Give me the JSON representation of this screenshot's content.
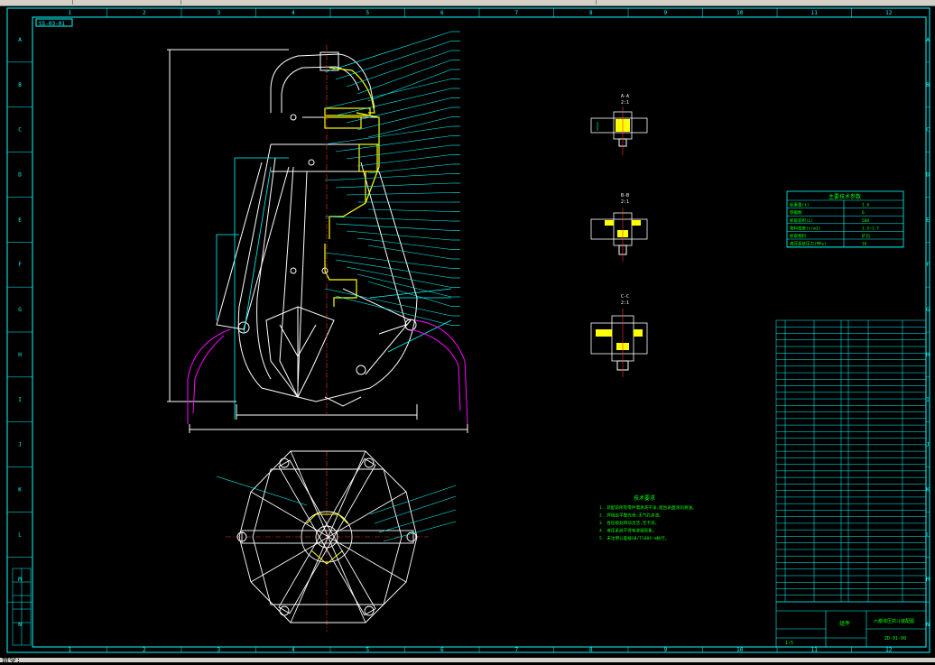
{
  "app": {
    "drawing_tag": "SS-03-01",
    "command_prompt": "命令:"
  },
  "border": {
    "columns": [
      "1",
      "2",
      "3",
      "4",
      "5",
      "6",
      "7",
      "8",
      "9",
      "10",
      "11",
      "12"
    ],
    "rows": [
      "A",
      "B",
      "C",
      "D",
      "E",
      "F",
      "G",
      "H",
      "I",
      "J",
      "K",
      "L",
      "M",
      "N"
    ]
  },
  "sections": [
    {
      "title": "A-A",
      "scale": "2:1"
    },
    {
      "title": "B-B",
      "scale": "2:1"
    },
    {
      "title": "C-C",
      "scale": "2:1"
    }
  ],
  "tech_table": {
    "title": "主要技术参数",
    "rows": [
      {
        "k": "起重量(t)",
        "v": "1.6"
      },
      {
        "k": "颚瓣数",
        "v": "6"
      },
      {
        "k": "抓取容积(L)",
        "v": "500"
      },
      {
        "k": "物料密度(t/m3)",
        "v": "1.5~1.7"
      },
      {
        "k": "抓取物料",
        "v": "矿石"
      },
      {
        "k": "液压系统压力(MPa)",
        "v": "16"
      }
    ]
  },
  "notes": {
    "title": "技术要求",
    "lines": [
      "1. 装配前所有零件需清洗干净,配合表面涂润滑油。",
      "2. 焊缝应平整光滑,无气孔夹渣。",
      "3. 各铰接处转动灵活,无卡滞。",
      "4. 液压系统不得有渗漏现象。",
      "5. 未注明公差按GB/T1804-m执行。"
    ]
  },
  "title_block": {
    "name": "六瓣液压抓斗装配图",
    "material": "组件",
    "scale": "1:5",
    "drawing_no": "ZD-01-00"
  },
  "colors": {
    "frame": "#00ffff",
    "drawing": "#ffffff",
    "highlight": "#ffff00",
    "section": "#00ff00",
    "magenta": "#ff00ff",
    "red": "#ff3030"
  }
}
